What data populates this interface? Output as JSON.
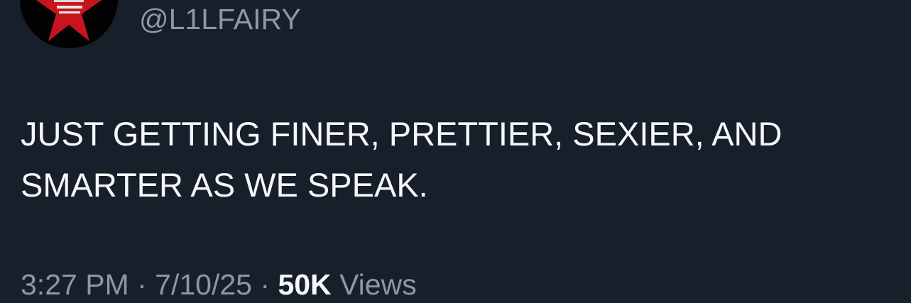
{
  "tweet": {
    "avatar_icon": "star-emblem-avatar",
    "handle": "@L1LFAIRY",
    "text": "JUST GETTING FINER, PRETTIER, SEXIER, AND\nSMARTER AS WE SPEAK.",
    "time": "3:27 PM",
    "separator": "·",
    "date": "7/10/25",
    "views_count": "50K",
    "views_label": "Views"
  },
  "colors": {
    "background": "#171f2a",
    "primary_text": "#f5f7f9",
    "secondary_text": "#8b98a5",
    "avatar_star": "#c8141e"
  }
}
